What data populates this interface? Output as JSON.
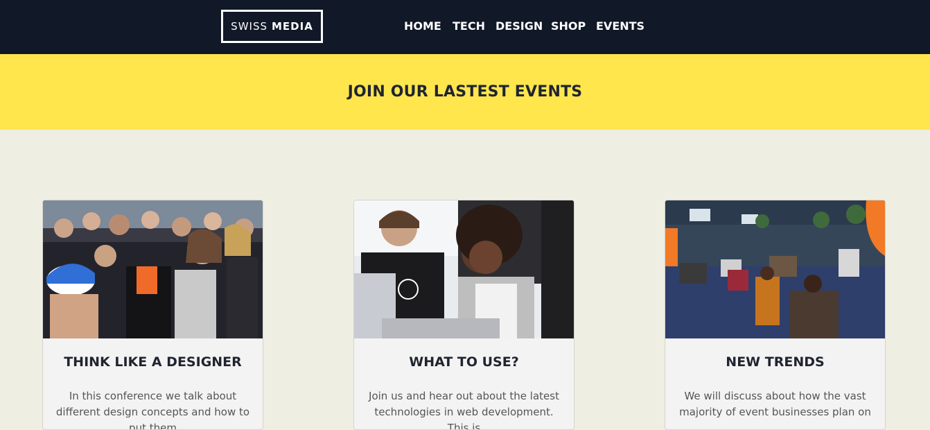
{
  "header": {
    "logo": {
      "light": "SWISS",
      "bold": "MEDIA"
    },
    "nav": [
      "HOME",
      "TECH",
      "DESIGN",
      "SHOP",
      "EVENTS"
    ]
  },
  "banner": {
    "title": "JOIN OUR LASTEST EVENTS"
  },
  "cards": [
    {
      "title": "THINK LIKE A DESIGNER",
      "text": "In this conference we talk about different design concepts and how to put them",
      "image": "crowd-photo"
    },
    {
      "title": "WHAT TO USE?",
      "text": "Join us and hear out about the latest technologies in web development. This is",
      "image": "laptop-team-photo"
    },
    {
      "title": "NEW TRENDS",
      "text": "We will discuss about how the vast majority of event businesses plan on",
      "image": "event-hall-photo"
    }
  ],
  "colors": {
    "topbar": "#111827",
    "banner": "#ffe64d",
    "page": "#eeeee2",
    "card": "#f4f3f3"
  }
}
